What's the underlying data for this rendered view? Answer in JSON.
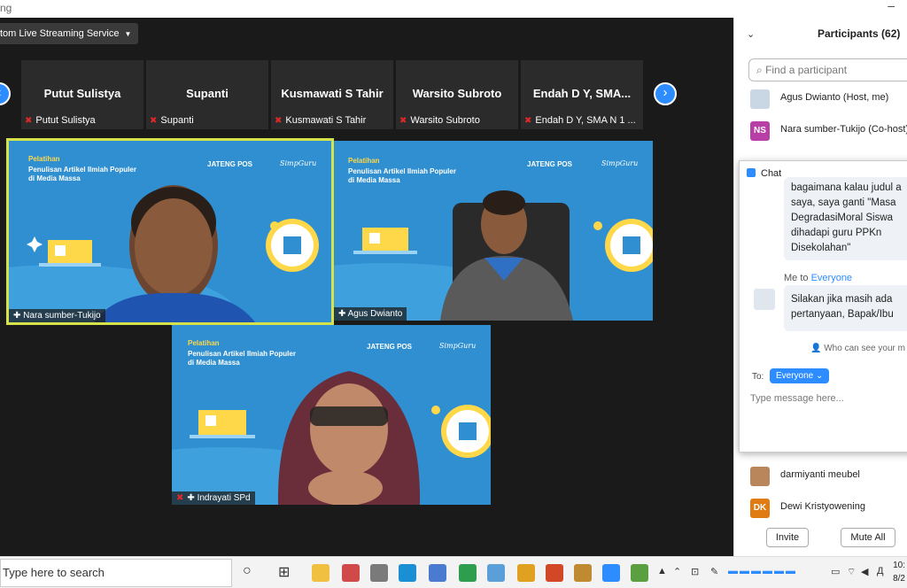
{
  "window": {
    "title_fragment": "ng"
  },
  "stream_button": {
    "label": "tom Live Streaming Service"
  },
  "strip": {
    "thumbnails": [
      {
        "name": "Putut Sulistya",
        "tag": "Putut Sulistya"
      },
      {
        "name": "Supanti",
        "tag": "Supanti"
      },
      {
        "name": "Kusmawati S Tahir",
        "tag": "Kusmawati S Tahir"
      },
      {
        "name": "Warsito Subroto",
        "tag": "Warsito Subroto"
      },
      {
        "name": "Endah D Y, SMA...",
        "tag": "Endah D Y, SMA N 1 ..."
      }
    ]
  },
  "banner": {
    "line1": "Pelatihan",
    "line2": "Penulisan Artikel Ilmiah Populer",
    "line3": "di Media Massa",
    "brand": "JATENG POS",
    "brand2": "SimpGuru"
  },
  "tiles": [
    {
      "name": "Nara sumber-Tukijo"
    },
    {
      "name": "Agus Dwianto"
    },
    {
      "name": "Indrayati SPd"
    }
  ],
  "participants_panel": {
    "title": "Participants (62)",
    "search_placeholder": "Find a participant",
    "rows": [
      {
        "initials": "",
        "name": "Agus Dwianto (Host, me)",
        "color": "#c9d6e3"
      },
      {
        "initials": "NS",
        "name": "Nara sumber-Tukijo (Co-host)",
        "color": "#b83fa6"
      },
      {
        "initials": "",
        "name": "darmiyanti meubel",
        "color": "#b8865a"
      },
      {
        "initials": "DK",
        "name": "Dewi Kristyowening",
        "color": "#e07a12"
      }
    ],
    "invite_label": "Invite",
    "mute_all_label": "Mute All"
  },
  "chat": {
    "title": "Chat",
    "message1": "bagaimana kalau judul a saya, saya ganti \"Masa DegradasiMoral Siswa dihadapi guru PPKn Disekolahan\"",
    "from_me": "Me to",
    "to_everyone": "Everyone",
    "message2": "Silakan jika masih ada pertanyaan, Bapak/Ibu",
    "who_can_see": "Who can see your m",
    "to_label": "To:",
    "recipient": "Everyone",
    "input_placeholder": "Type message here..."
  },
  "taskbar": {
    "search_placeholder": "Type here to search",
    "clock_time": "10:",
    "clock_date": "8/2"
  }
}
